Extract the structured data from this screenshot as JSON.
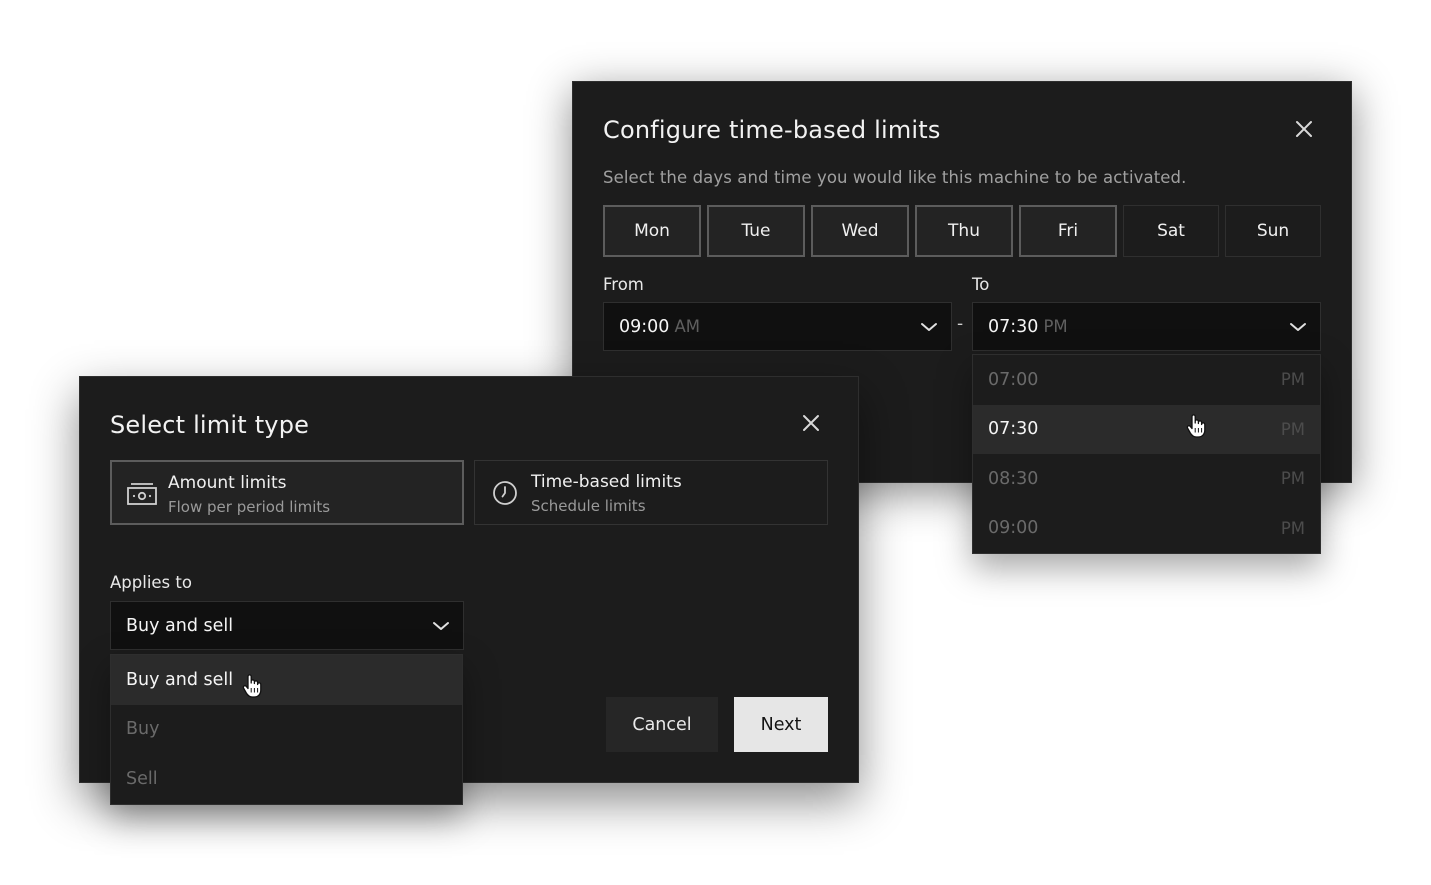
{
  "config_dialog": {
    "title": "Configure time-based limits",
    "subtitle": "Select the days and time you would like this machine to be activated.",
    "days": [
      {
        "label": "Mon",
        "selected": true
      },
      {
        "label": "Tue",
        "selected": true
      },
      {
        "label": "Wed",
        "selected": true
      },
      {
        "label": "Thu",
        "selected": true
      },
      {
        "label": "Fri",
        "selected": true
      },
      {
        "label": "Sat",
        "selected": false
      },
      {
        "label": "Sun",
        "selected": false
      }
    ],
    "from_label": "From",
    "to_label": "To",
    "from_time": "09:00",
    "from_ampm": "AM",
    "to_time": "07:30",
    "to_ampm": "PM",
    "separator": "-",
    "to_options": [
      {
        "time": "07:00",
        "ampm": "PM"
      },
      {
        "time": "07:30",
        "ampm": "PM",
        "active": true
      },
      {
        "time": "08:30",
        "ampm": "PM"
      },
      {
        "time": "09:00",
        "ampm": "PM"
      }
    ]
  },
  "limit_dialog": {
    "title": "Select limit type",
    "types": [
      {
        "name": "Amount limits",
        "desc": "Flow per period limits",
        "icon": "cash-icon",
        "selected": true
      },
      {
        "name": "Time-based limits",
        "desc": "Schedule limits",
        "icon": "clock-icon",
        "selected": false
      }
    ],
    "applies_label": "Applies to",
    "applies_value": "Buy and sell",
    "applies_options": [
      {
        "label": "Buy and sell",
        "active": true
      },
      {
        "label": "Buy"
      },
      {
        "label": "Sell"
      }
    ],
    "cancel_label": "Cancel",
    "next_label": "Next"
  },
  "colors": {
    "dialog_bg": "#1c1c1c",
    "input_bg": "#101010",
    "selected_border": "#5c5c5c",
    "primary_button": "#e6e6e6"
  }
}
